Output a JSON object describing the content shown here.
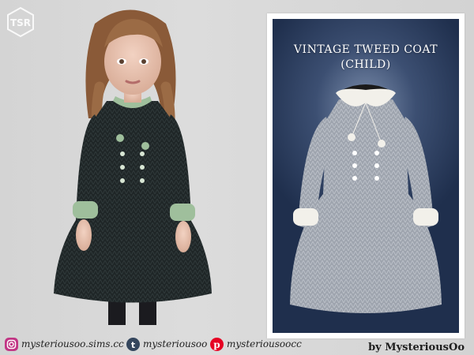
{
  "brand": {
    "logo_text": "TSR"
  },
  "card": {
    "title_line1": "VINTAGE TWEED COAT",
    "title_line2": "(CHILD)"
  },
  "footer": {
    "instagram": "mysteriousoo.sims.cc",
    "tumblr": "mysteriousoo",
    "pinterest": "mysteriousoocc",
    "credit": "by MysteriousOo"
  },
  "icons": [
    "instagram-icon",
    "tumblr-icon",
    "pinterest-icon",
    "tsr-logo-icon"
  ],
  "colors": {
    "instagram": "#c13584",
    "tumblr": "#34465d",
    "pinterest": "#e60023",
    "card_bg": "#2d4063",
    "coat_left": "#1f2627",
    "coat_right": "#9ea4ae",
    "collar_left": "#9fbf9c",
    "collar_right": "#f2f0ea"
  }
}
